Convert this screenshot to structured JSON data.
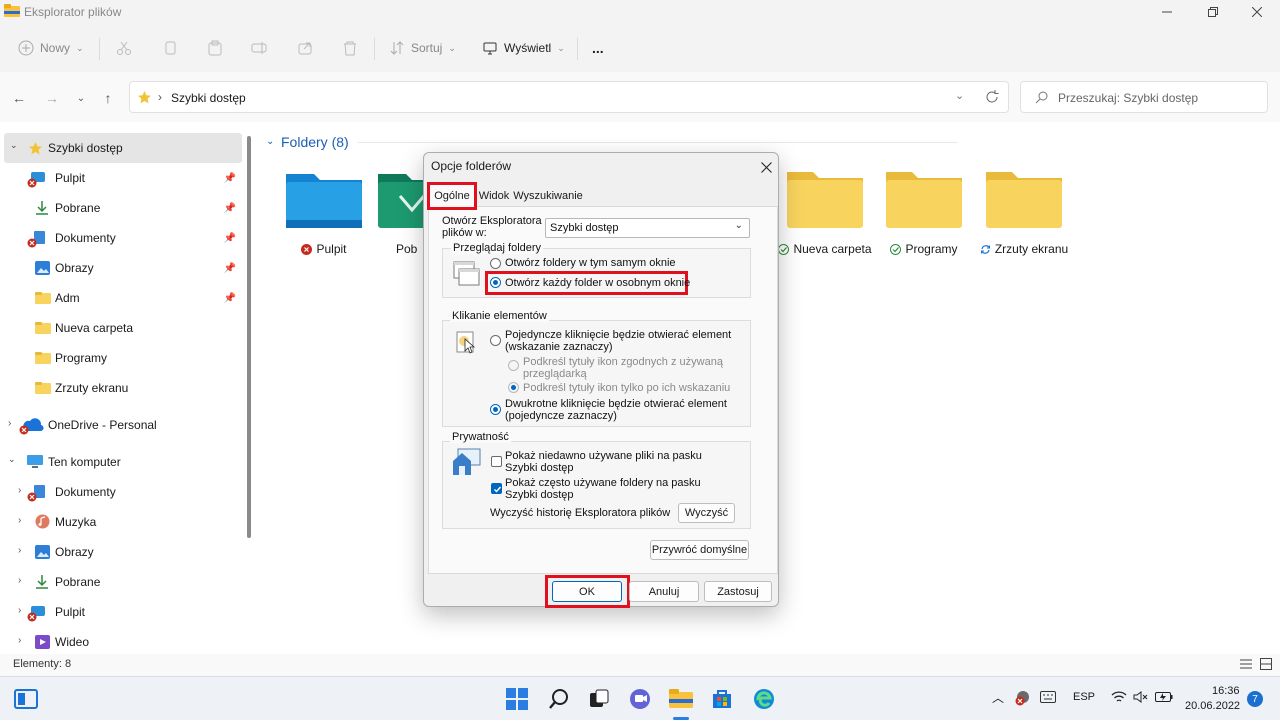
{
  "window": {
    "title": "Eksplorator plików"
  },
  "toolbar": {
    "new": "Nowy",
    "sort": "Sortuj",
    "view": "Wyświetl",
    "more": "..."
  },
  "address": {
    "path": "Szybki dostęp",
    "search_placeholder": "Przeszukaj: Szybki dostęp"
  },
  "sidebar": {
    "quick_access": "Szybki dostęp",
    "items": [
      {
        "label": "Pulpit",
        "pinned": true
      },
      {
        "label": "Pobrane",
        "pinned": true
      },
      {
        "label": "Dokumenty",
        "pinned": true
      },
      {
        "label": "Obrazy",
        "pinned": true
      },
      {
        "label": "Adm",
        "pinned": true
      },
      {
        "label": "Nueva carpeta",
        "pinned": false
      },
      {
        "label": "Programy",
        "pinned": false
      },
      {
        "label": "Zrzuty ekranu",
        "pinned": false
      }
    ],
    "onedrive": "OneDrive - Personal",
    "this_pc": "Ten komputer",
    "pc_items": [
      "Dokumenty",
      "Muzyka",
      "Obrazy",
      "Pobrane",
      "Pulpit",
      "Wideo"
    ]
  },
  "main": {
    "section_title": "Foldery (8)",
    "folders": [
      {
        "label": "Pulpit",
        "status": "error"
      },
      {
        "label": "Pob",
        "status": "none"
      },
      {
        "label": "Nueva carpeta",
        "status": "ok"
      },
      {
        "label": "Programy",
        "status": "ok"
      },
      {
        "label": "Zrzuty ekranu",
        "status": "sync"
      }
    ]
  },
  "status": {
    "items": "Elementy: 8"
  },
  "dialog": {
    "title": "Opcje folderów",
    "tabs": [
      "Ogólne",
      "Widok",
      "Wyszukiwanie"
    ],
    "open_label": "Otwórz Eksploratora plików w:",
    "open_value": "Szybki dostęp",
    "browse": {
      "legend": "Przeglądaj foldery",
      "opt1": "Otwórz foldery w tym samym oknie",
      "opt2": "Otwórz każdy folder w osobnym oknie",
      "selected": 2
    },
    "click": {
      "legend": "Klikanie elementów",
      "single": "Pojedyncze kliknięcie będzie otwierać element (wskazanie zaznaczy)",
      "sub1": "Podkreśl tytuły ikon zgodnych z używaną przeglądarką",
      "sub2": "Podkreśl tytuły ikon tylko po ich wskazaniu",
      "double": "Dwukrotne kliknięcie będzie otwierać element (pojedyncze zaznaczy)"
    },
    "privacy": {
      "legend": "Prywatność",
      "recent_files": "Pokaż niedawno używane pliki na pasku Szybki dostęp",
      "frequent_folders": "Pokaż często używane foldery na pasku Szybki dostęp",
      "recent_checked": false,
      "frequent_checked": true,
      "clear_label": "Wyczyść historię Eksploratora plików",
      "clear_button": "Wyczyść"
    },
    "restore_defaults": "Przywróć domyślne",
    "ok": "OK",
    "cancel": "Anuluj",
    "apply": "Zastosuj"
  },
  "taskbar": {
    "lang": "ESP",
    "time": "16:36",
    "date": "20.06.2022",
    "badge": "7"
  },
  "colors": {
    "accent": "#0067c0",
    "highlight": "#e0101f",
    "folder_yellow": "#f8d35e"
  }
}
